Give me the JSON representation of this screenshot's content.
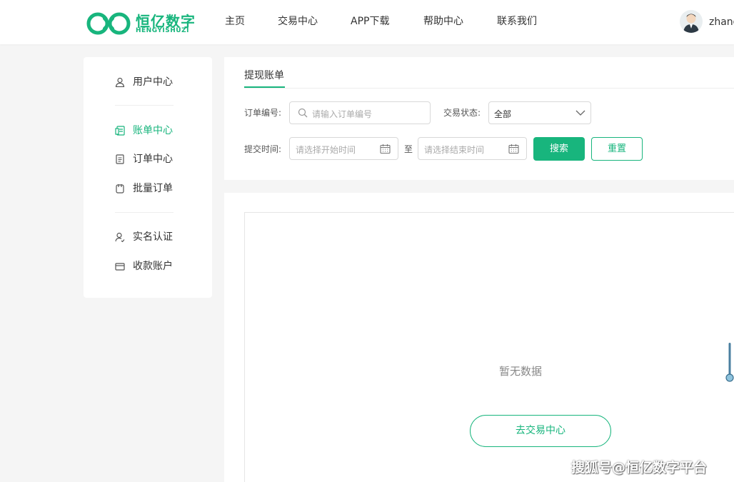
{
  "brand": {
    "name_cn": "恒亿数字",
    "name_en": "HENGYISHUZI",
    "accent_color": "#18b57d"
  },
  "nav": {
    "items": [
      {
        "label": "主页"
      },
      {
        "label": "交易中心"
      },
      {
        "label": "APP下载"
      },
      {
        "label": "帮助中心"
      },
      {
        "label": "联系我们"
      }
    ],
    "username": "zhang",
    "avatar_icon": "user-avatar-icon"
  },
  "sidebar": {
    "active_index": 1,
    "items": [
      {
        "label": "用户中心",
        "icon": "user-icon"
      },
      {
        "label": "账单中心",
        "icon": "bill-icon"
      },
      {
        "label": "订单中心",
        "icon": "order-list-icon"
      },
      {
        "label": "批量订单",
        "icon": "batch-order-icon"
      },
      {
        "label": "实名认证",
        "icon": "identity-icon"
      },
      {
        "label": "收款账户",
        "icon": "card-icon"
      }
    ]
  },
  "filters": {
    "tab": "提现账单",
    "order_no_label": "订单编号:",
    "order_no_placeholder": "请输入订单编号",
    "status_label": "交易状态:",
    "status_value": "全部",
    "time_label": "提交时间:",
    "start_placeholder": "请选择开始时间",
    "range_separator": "至",
    "end_placeholder": "请选择结束时间",
    "search_button": "搜索",
    "reset_button": "重置"
  },
  "results": {
    "empty_text": "暂无数据",
    "goto_button": "去交易中心"
  },
  "watermark": "搜狐号@恒亿数字平台"
}
